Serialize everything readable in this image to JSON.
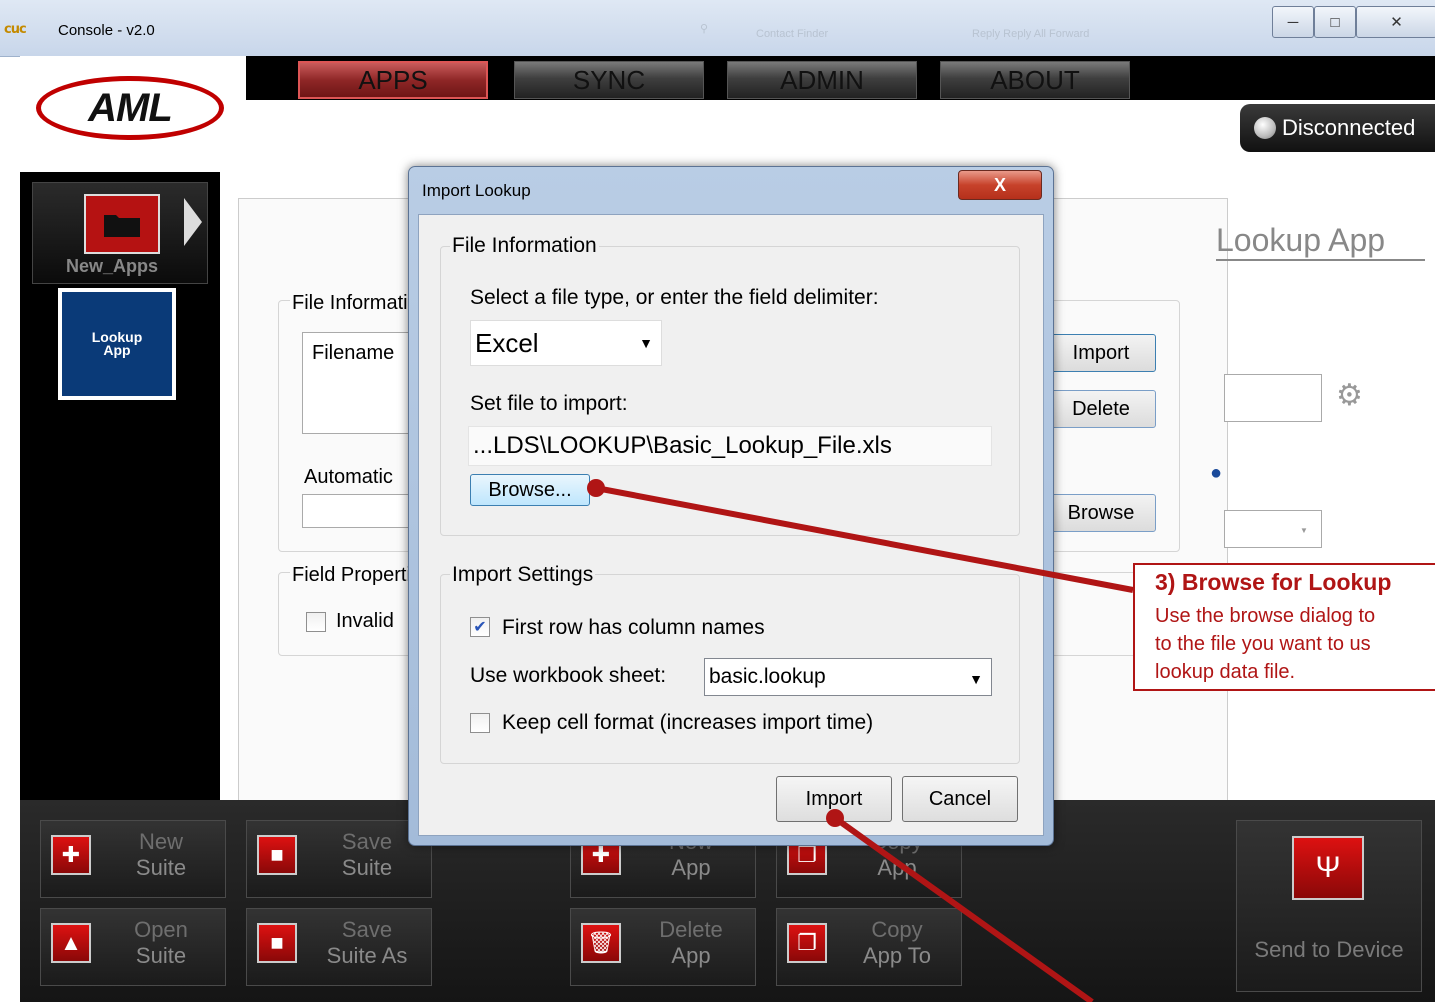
{
  "window": {
    "title": "Console - v2.0",
    "logo_glyph": "cuc",
    "faded_search_text": "Contact Finder",
    "faded_toolbar_text": "Reply   Reply All   Forward"
  },
  "brand": {
    "logo_text": "AML",
    "accent": "#c00000"
  },
  "nav": {
    "tabs": [
      {
        "label": "APPS",
        "active": true
      },
      {
        "label": "SYNC",
        "active": false
      },
      {
        "label": "ADMIN",
        "active": false
      },
      {
        "label": "ABOUT",
        "active": false
      }
    ]
  },
  "status": {
    "label": "Disconnected"
  },
  "sidebar": {
    "suite_name": "New_Apps",
    "app_tile": {
      "line1": "Lookup",
      "line2": "App"
    }
  },
  "background_form": {
    "page_title": "Lookup App",
    "file_info_label": "File Information",
    "filename_header": "Filename",
    "automatic_label": "Automatic",
    "field_properties_label": "Field Properties",
    "invalid_label": "Invalid",
    "import_button": "Import",
    "delete_button": "Delete",
    "browse_button": "Browse"
  },
  "toolbar": {
    "buttons": [
      {
        "line1": "New",
        "line2": "Suite",
        "icon": "plus-icon"
      },
      {
        "line1": "Save",
        "line2": "Suite",
        "icon": "save-icon"
      },
      {
        "line1": "New",
        "line2": "App",
        "icon": "plus-icon"
      },
      {
        "line1": "Copy",
        "line2": "App",
        "icon": "copy-icon"
      },
      {
        "line1": "Open",
        "line2": "Suite",
        "icon": "open-folder-icon"
      },
      {
        "line1": "Save",
        "line2": "Suite As",
        "icon": "save-as-icon"
      },
      {
        "line1": "Delete",
        "line2": "App",
        "icon": "trash-icon"
      },
      {
        "line1": "Copy",
        "line2": "App To",
        "icon": "copy-to-icon"
      }
    ],
    "send_to_device": "Send to Device"
  },
  "dialog": {
    "title": "Import Lookup",
    "close_label": "X",
    "file_info_group": "File Information",
    "filetype_prompt": "Select a file type, or enter the field delimiter:",
    "filetype_value": "Excel",
    "set_file_label": "Set file to import:",
    "file_path": "...LDS\\LOOKUP\\Basic_Lookup_File.xls",
    "browse_label": "Browse...",
    "import_settings_group": "Import Settings",
    "first_row_label": "First row has column names",
    "first_row_checked": true,
    "workbook_sheet_label": "Use workbook sheet:",
    "workbook_sheet_value": "basic.lookup",
    "keep_format_label": "Keep cell format (increases import time)",
    "keep_format_checked": false,
    "import_button": "Import",
    "cancel_button": "Cancel"
  },
  "callout": {
    "heading": "3) Browse for Lookup",
    "lines": [
      "Use the browse dialog to",
      "to the file you want to us",
      "lookup data file."
    ],
    "color": "#b01515"
  }
}
